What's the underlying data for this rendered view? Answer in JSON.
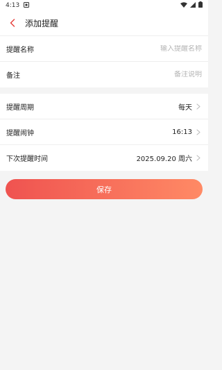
{
  "status_bar": {
    "time": "4:13"
  },
  "header": {
    "title": "添加提醒"
  },
  "form": {
    "name": {
      "label": "提醒名称",
      "placeholder": "输入提醒名称",
      "value": ""
    },
    "note": {
      "label": "备注",
      "placeholder": "备注说明",
      "value": ""
    }
  },
  "schedule": {
    "period": {
      "label": "提醒周期",
      "value": "每天"
    },
    "alarm": {
      "label": "提醒闹钟",
      "value": "16:13"
    },
    "next": {
      "label": "下次提醒时间",
      "value": "2025.09.20 周六"
    }
  },
  "actions": {
    "save_label": "保存"
  },
  "colors": {
    "accent_start": "#ef5350",
    "accent_end": "#ff8a65",
    "back_icon": "#e53935"
  }
}
